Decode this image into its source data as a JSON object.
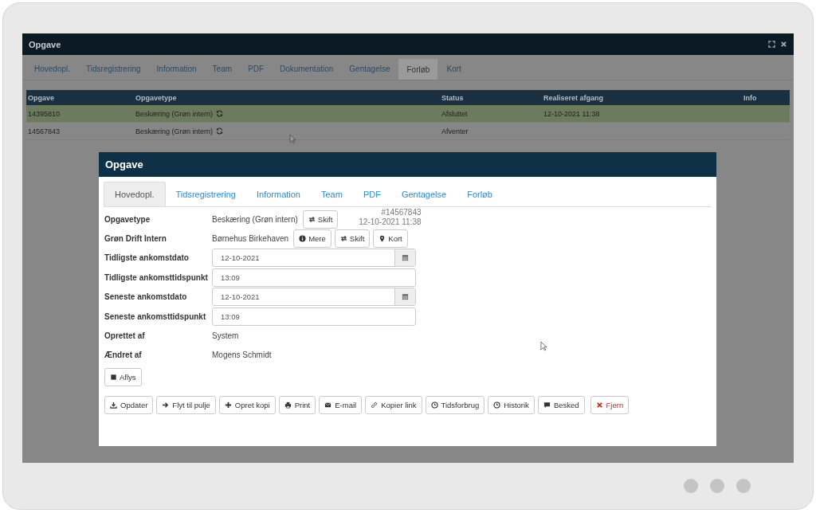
{
  "window": {
    "title": "Opgave"
  },
  "tabs": [
    {
      "label": "Hovedopl.",
      "selected": false
    },
    {
      "label": "Tidsregistrering",
      "selected": false
    },
    {
      "label": "Information",
      "selected": false
    },
    {
      "label": "Team",
      "selected": false
    },
    {
      "label": "PDF",
      "selected": false
    },
    {
      "label": "Dokumentation",
      "selected": false
    },
    {
      "label": "Gentagelse",
      "selected": false
    },
    {
      "label": "Forløb",
      "selected": true
    },
    {
      "label": "Kort",
      "selected": false
    }
  ],
  "table": {
    "columns": [
      "Opgave",
      "Opgavetype",
      "Status",
      "Realiseret afgang",
      "Info"
    ],
    "rows": [
      {
        "cells": [
          "14395810",
          "Beskæring (Grøn intern)",
          "Afsluttet",
          "12-10-2021 11:38",
          ""
        ],
        "selected": true
      },
      {
        "cells": [
          "14567843",
          "Beskæring (Grøn intern)",
          "Afventer",
          "",
          ""
        ],
        "selected": false
      }
    ]
  },
  "dialog": {
    "title": "Opgave",
    "tabs": [
      {
        "label": "Hovedopl.",
        "selected": true
      },
      {
        "label": "Tidsregistrering",
        "selected": false
      },
      {
        "label": "Information",
        "selected": false
      },
      {
        "label": "Team",
        "selected": false
      },
      {
        "label": "PDF",
        "selected": false
      },
      {
        "label": "Gentagelse",
        "selected": false
      },
      {
        "label": "Forløb",
        "selected": false
      }
    ],
    "fields": [
      {
        "kind": "text",
        "label": "Opgavetype",
        "value": "Beskæring (Grøn intern)",
        "buttons": [
          {
            "kind": "swap",
            "label": "Skift"
          }
        ],
        "meta": [
          "#14567843",
          "12-10-2021 11:38"
        ]
      },
      {
        "kind": "text",
        "label": "Grøn Drift Intern",
        "value": "Børnehus Birkehaven",
        "buttons": [
          {
            "kind": "info",
            "label": "Mere"
          },
          {
            "kind": "swap",
            "label": "Skift"
          },
          {
            "kind": "pin",
            "label": "Kort"
          }
        ]
      },
      {
        "kind": "date",
        "label": "Tidligste ankomstdato",
        "value": "12-10-2021"
      },
      {
        "kind": "time",
        "label": "Tidligste ankomsttidspunkt",
        "value": "13:09"
      },
      {
        "kind": "date",
        "label": "Seneste ankomstdato",
        "value": "12-10-2021"
      },
      {
        "kind": "time",
        "label": "Seneste ankomsttidspunkt",
        "value": "13:09"
      },
      {
        "kind": "text",
        "label": "Oprettet af",
        "value": "System"
      },
      {
        "kind": "text",
        "label": "Ændret af",
        "value": "Mogens Schmidt"
      }
    ],
    "cancel_button": "Aflys",
    "actions": [
      {
        "kind": "download",
        "label": "Opdater"
      },
      {
        "kind": "arrow",
        "label": "Flyt til pulje"
      },
      {
        "kind": "plus",
        "label": "Opret kopi"
      },
      {
        "kind": "print",
        "label": "Print"
      },
      {
        "kind": "mail",
        "label": "E-mail"
      },
      {
        "kind": "link",
        "label": "Kopier link"
      },
      {
        "kind": "clock",
        "label": "Tidsforbrug"
      },
      {
        "kind": "clock",
        "label": "Historik"
      },
      {
        "kind": "comment",
        "label": "Besked"
      },
      {
        "kind": "danger",
        "label": "Fjern"
      }
    ]
  }
}
